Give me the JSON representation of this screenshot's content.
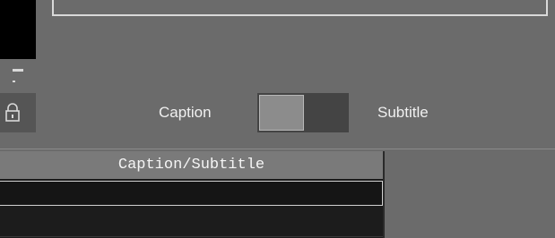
{
  "toggle": {
    "left_label": "Caption",
    "right_label": "Subtitle",
    "selected": "Caption"
  },
  "lock_button": {
    "icon": "lock-icon"
  },
  "table": {
    "header": "Caption/Subtitle",
    "rows": [
      "",
      ""
    ]
  },
  "colors": {
    "panel_bg": "#6b6b6b",
    "text": "#f0f0f0",
    "header_bg": "#7a7a7a",
    "row_bg": "#151515"
  }
}
